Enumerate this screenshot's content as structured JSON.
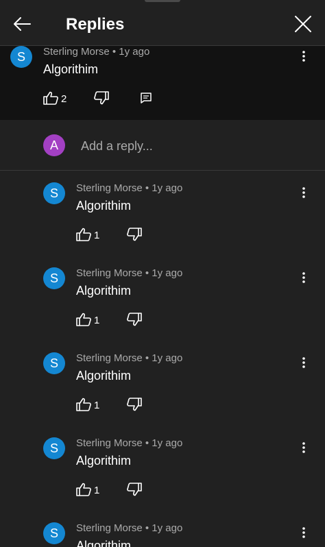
{
  "header": {
    "title": "Replies",
    "back_icon": "arrow-left-icon",
    "close_icon": "close-icon"
  },
  "parent_comment": {
    "avatar_letter": "S",
    "avatar_color": "#1487d2",
    "meta": "Sterling Morse • 1y ago",
    "text": "Algorithim",
    "likes": "2"
  },
  "reply_box": {
    "avatar_letter": "A",
    "avatar_color": "#a340c3",
    "placeholder": "Add a reply..."
  },
  "replies": [
    {
      "avatar_letter": "S",
      "meta": "Sterling Morse • 1y ago",
      "text": "Algorithim",
      "likes": "1"
    },
    {
      "avatar_letter": "S",
      "meta": "Sterling Morse • 1y ago",
      "text": "Algorithim",
      "likes": "1"
    },
    {
      "avatar_letter": "S",
      "meta": "Sterling Morse • 1y ago",
      "text": "Algorithim",
      "likes": "1"
    },
    {
      "avatar_letter": "S",
      "meta": "Sterling Morse • 1y ago",
      "text": "Algorithim",
      "likes": "1"
    },
    {
      "avatar_letter": "S",
      "meta": "Sterling Morse • 1y ago",
      "text": "Algorithim",
      "likes": ""
    }
  ]
}
